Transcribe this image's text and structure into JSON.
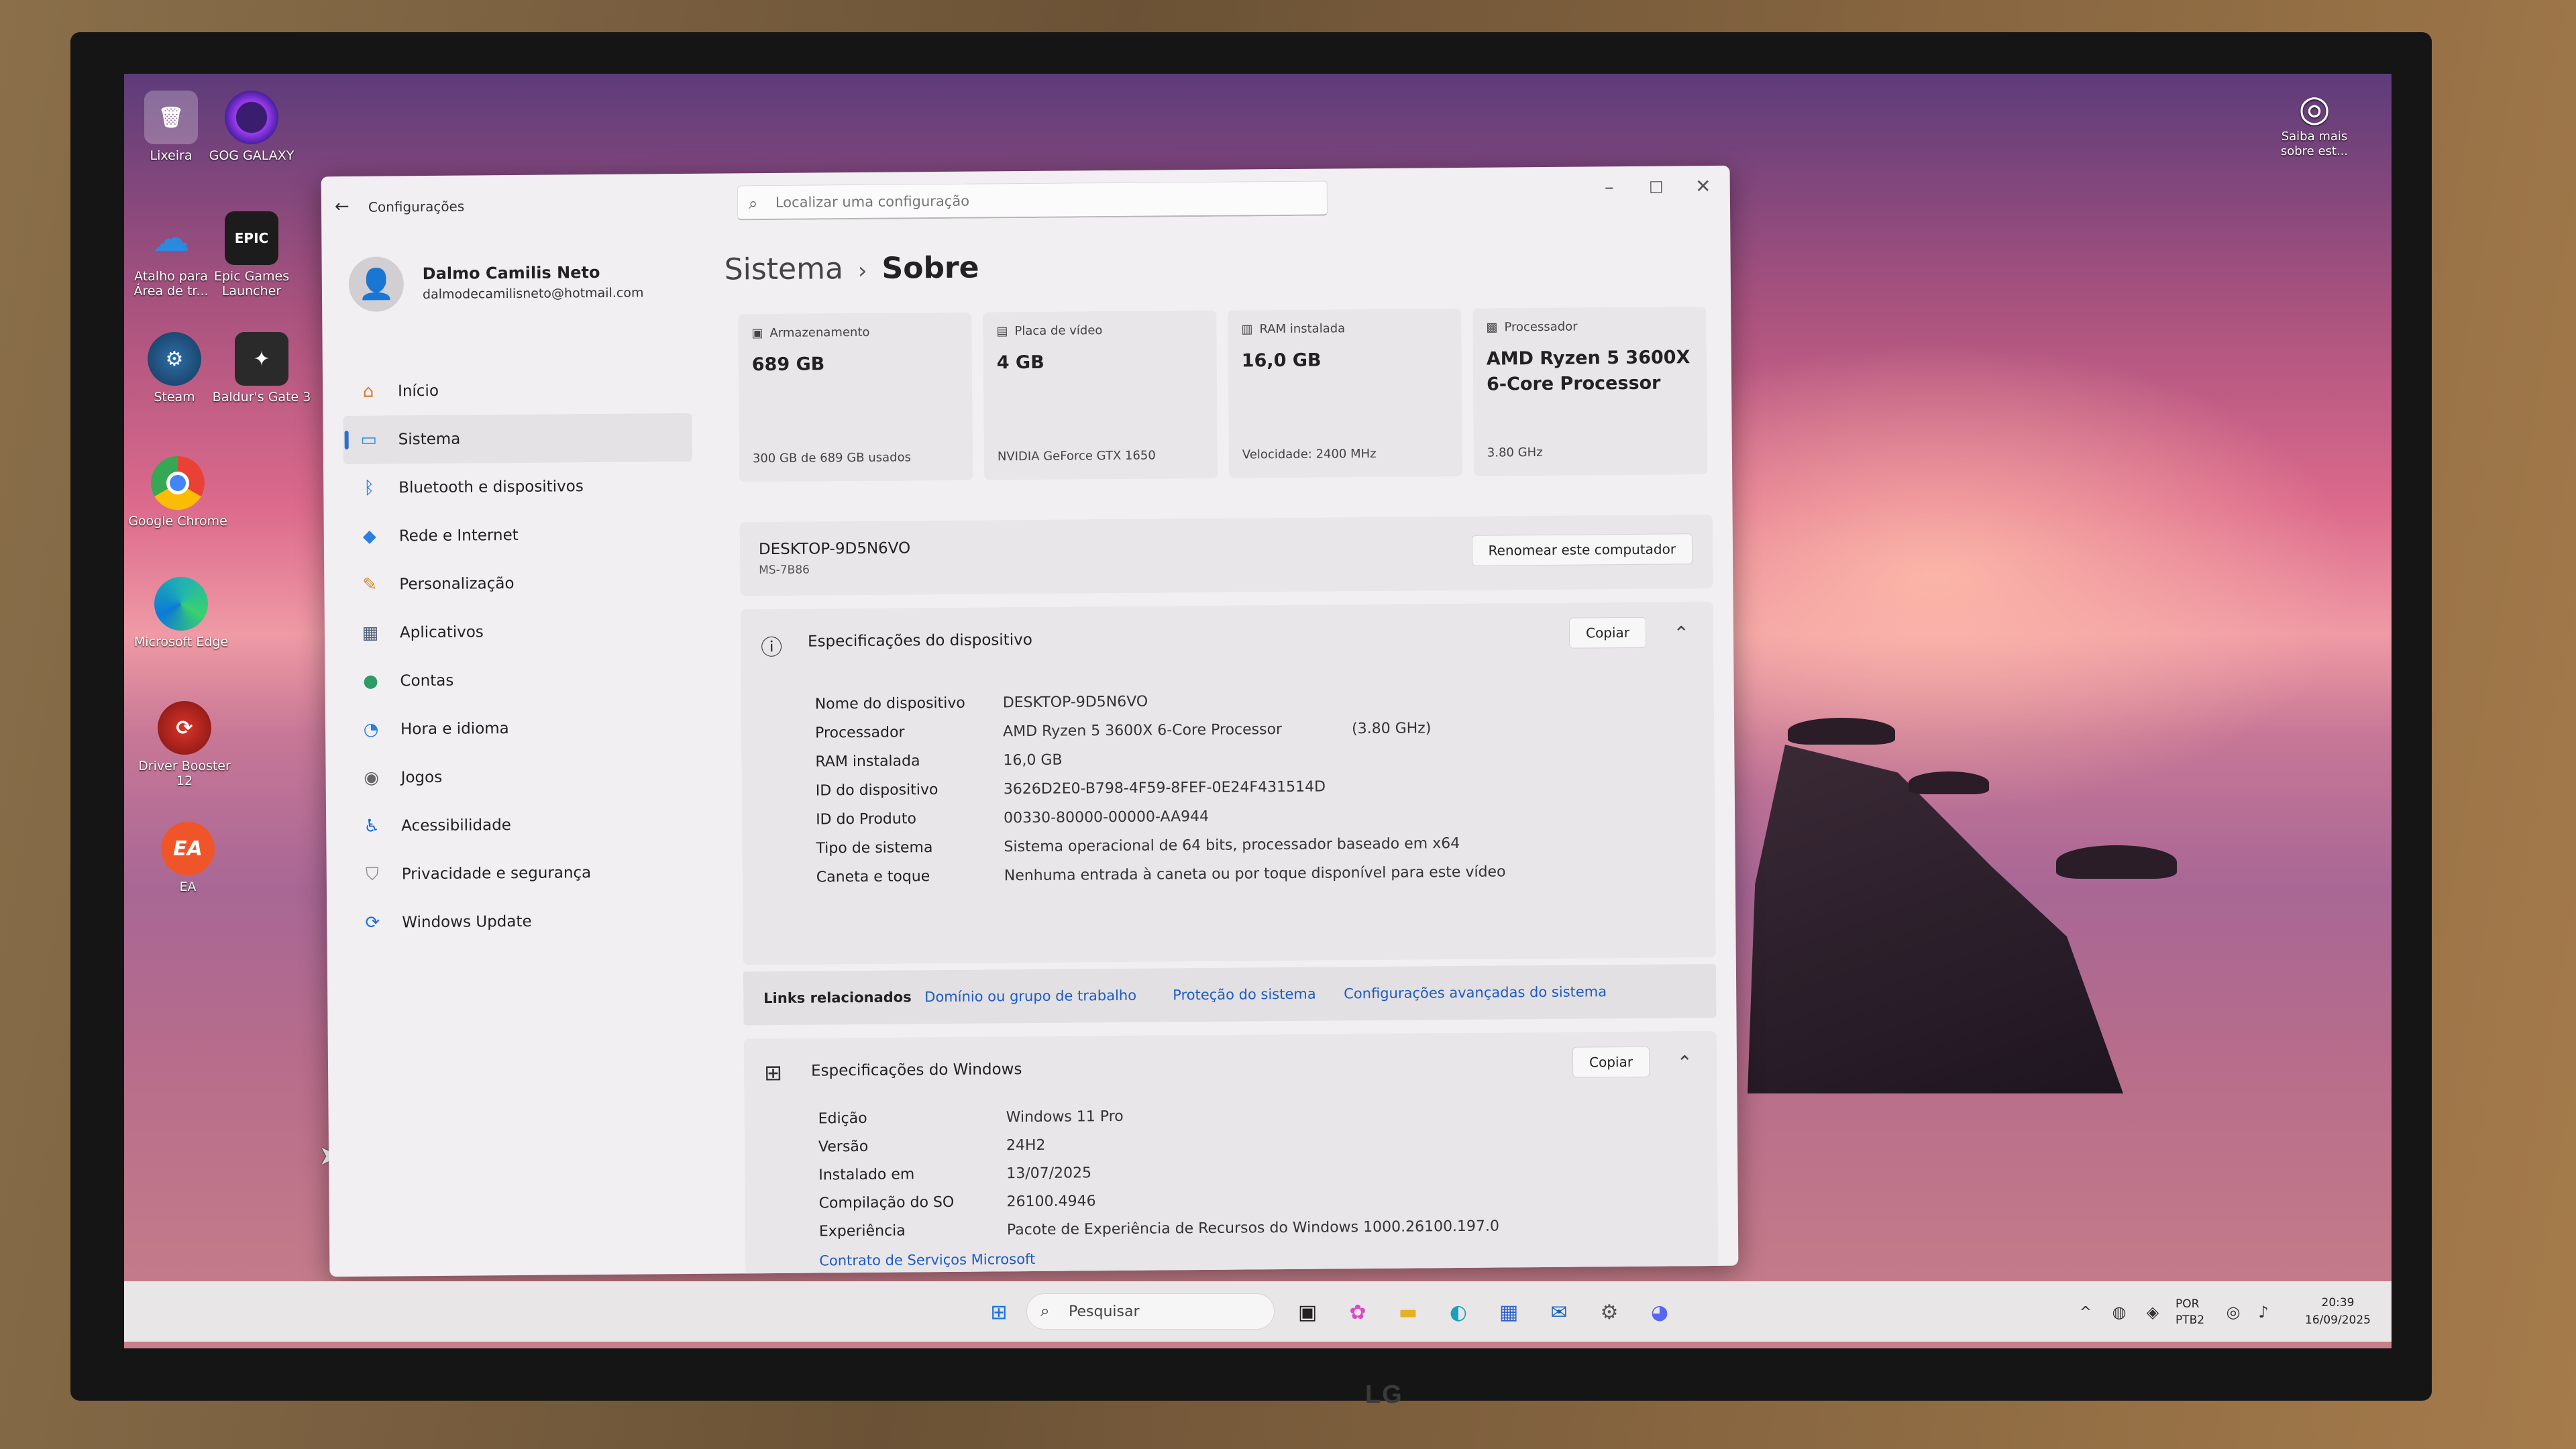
{
  "desktop": {
    "icons": [
      {
        "label": "Lixeira",
        "icon": "recycle-bin-icon"
      },
      {
        "label": "GOG GALAXY",
        "icon": "gog-galaxy-icon"
      },
      {
        "label": "Atalho para Área de tr...",
        "icon": "onedrive-icon"
      },
      {
        "label": "Epic Games Launcher",
        "icon": "epic-games-icon",
        "glyph": "EPIC"
      },
      {
        "label": "Steam",
        "icon": "steam-icon"
      },
      {
        "label": "Baldur's Gate 3",
        "icon": "baldurs-gate-icon"
      },
      {
        "label": "Google Chrome",
        "icon": "chrome-icon"
      },
      {
        "label": "Microsoft Edge",
        "icon": "edge-icon"
      },
      {
        "label": "Driver Booster 12",
        "icon": "driver-booster-icon"
      },
      {
        "label": "EA",
        "icon": "ea-icon",
        "glyph": "EA"
      }
    ],
    "learn_more": "Saiba mais sobre est..."
  },
  "window": {
    "app_title": "Configurações",
    "search_placeholder": "Localizar uma configuração"
  },
  "profile": {
    "name": "Dalmo Camilis Neto",
    "email": "dalmodecamilisneto@hotmail.com"
  },
  "nav": {
    "items": [
      {
        "label": "Início",
        "icon": "home-icon",
        "color": "#d9772b"
      },
      {
        "label": "Sistema",
        "icon": "system-icon",
        "color": "#2e8fe0"
      },
      {
        "label": "Bluetooth e dispositivos",
        "icon": "bluetooth-icon",
        "color": "#1f73d6"
      },
      {
        "label": "Rede e Internet",
        "icon": "network-icon",
        "color": "#2a7fe0"
      },
      {
        "label": "Personalização",
        "icon": "brush-icon",
        "color": "#d38a2a"
      },
      {
        "label": "Aplicativos",
        "icon": "apps-icon",
        "color": "#4a5a78"
      },
      {
        "label": "Contas",
        "icon": "accounts-icon",
        "color": "#2e9c66"
      },
      {
        "label": "Hora e idioma",
        "icon": "time-language-icon",
        "color": "#2a80d8"
      },
      {
        "label": "Jogos",
        "icon": "gaming-icon",
        "color": "#666"
      },
      {
        "label": "Acessibilidade",
        "icon": "accessibility-icon",
        "color": "#1b6bd0"
      },
      {
        "label": "Privacidade e segurança",
        "icon": "shield-icon",
        "color": "#888"
      },
      {
        "label": "Windows Update",
        "icon": "windows-update-icon",
        "color": "#1a72d6"
      }
    ]
  },
  "breadcrumb": {
    "parent": "Sistema",
    "separator": "›",
    "current": "Sobre"
  },
  "cards": [
    {
      "title": "Armazenamento",
      "value": "689 GB",
      "sub": "300 GB de 689 GB usados",
      "icon": "storage-icon"
    },
    {
      "title": "Placa de vídeo",
      "value": "4 GB",
      "sub": "NVIDIA GeForce GTX 1650",
      "icon": "gpu-icon"
    },
    {
      "title": "RAM instalada",
      "value": "16,0 GB",
      "sub": "Velocidade: 2400 MHz",
      "icon": "ram-icon"
    },
    {
      "title": "Processador",
      "value": "AMD Ryzen 5 3600X 6-Core Processor",
      "sub": "3.80 GHz",
      "icon": "cpu-icon"
    }
  ],
  "pc": {
    "name": "DESKTOP-9D5N6VO",
    "model": "MS-7B86",
    "rename_label": "Renomear este computador"
  },
  "device_specs": {
    "title": "Especificações do dispositivo",
    "copy_label": "Copiar",
    "rows": [
      {
        "label": "Nome do dispositivo",
        "value": "DESKTOP-9D5N6VO"
      },
      {
        "label": "Processador",
        "value": "AMD Ryzen 5 3600X 6-Core Processor",
        "extra": "(3.80 GHz)"
      },
      {
        "label": "RAM instalada",
        "value": "16,0 GB"
      },
      {
        "label": "ID do dispositivo",
        "value": "3626D2E0-B798-4F59-8FEF-0E24F431514D"
      },
      {
        "label": "ID do Produto",
        "value": "00330-80000-00000-AA944"
      },
      {
        "label": "Tipo de sistema",
        "value": "Sistema operacional de 64 bits, processador baseado em x64"
      },
      {
        "label": "Caneta e toque",
        "value": "Nenhuma entrada à caneta ou por toque disponível para este vídeo"
      }
    ]
  },
  "related_links": {
    "label": "Links relacionados",
    "links": [
      "Domínio ou grupo de trabalho",
      "Proteção do sistema",
      "Configurações avançadas do sistema"
    ]
  },
  "windows_specs": {
    "title": "Especificações do Windows",
    "copy_label": "Copiar",
    "rows": [
      {
        "label": "Edição",
        "value": "Windows 11 Pro"
      },
      {
        "label": "Versão",
        "value": "24H2"
      },
      {
        "label": "Instalado em",
        "value": "13/07/2025"
      },
      {
        "label": "Compilação do SO",
        "value": "26100.4946"
      },
      {
        "label": "Experiência",
        "value": "Pacote de Experiência de Recursos do Windows 1000.26100.197.0"
      }
    ],
    "contract_link": "Contrato de Serviços Microsoft"
  },
  "taskbar": {
    "search_label": "Pesquisar",
    "lang_top": "POR",
    "lang_bottom": "PTB2",
    "time": "20:39",
    "date": "16/09/2025"
  },
  "monitor": {
    "brand": "LG"
  }
}
